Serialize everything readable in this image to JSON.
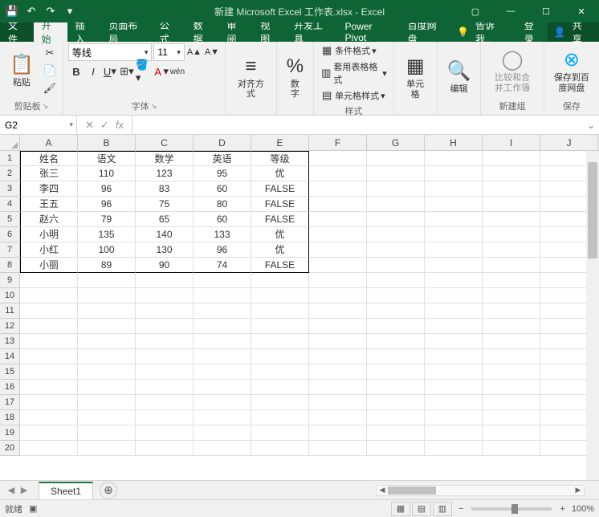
{
  "title": "新建 Microsoft Excel 工作表.xlsx - Excel",
  "tabs": {
    "file": "文件",
    "home": "开始",
    "insert": "插入",
    "layout": "页面布局",
    "formulas": "公式",
    "data": "数据",
    "review": "审阅",
    "view": "视图",
    "dev": "开发工具",
    "power": "Power Pivot",
    "baidu": "百度网盘",
    "tell_me": "告诉我...",
    "login": "登录",
    "share": "共享"
  },
  "ribbon": {
    "clipboard": {
      "paste": "粘贴",
      "label": "剪贴板"
    },
    "font": {
      "name": "等线",
      "size": "11",
      "label": "字体"
    },
    "align": {
      "label": "对齐方式"
    },
    "number": {
      "label": "数字"
    },
    "styles": {
      "cond": "条件格式",
      "tbl": "套用表格格式",
      "cell": "单元格样式",
      "label": "样式"
    },
    "cells": {
      "label": "单元格"
    },
    "editing": {
      "label": "编辑"
    },
    "newgroup": {
      "compare": "比较和合并工作簿",
      "label": "新建组"
    },
    "save": {
      "save_to": "保存到百度网盘",
      "label": "保存"
    }
  },
  "name_box": "G2",
  "formula": "",
  "columns": [
    "A",
    "B",
    "C",
    "D",
    "E",
    "F",
    "G",
    "H",
    "I",
    "J"
  ],
  "row_nums": [
    1,
    2,
    3,
    4,
    5,
    6,
    7,
    8,
    9,
    10,
    11,
    12,
    13,
    14,
    15,
    16,
    17,
    18,
    19,
    20
  ],
  "cells": {
    "A1": "姓名",
    "B1": "语文",
    "C1": "数学",
    "D1": "英语",
    "E1": "等级",
    "A2": "张三",
    "B2": "110",
    "C2": "123",
    "D2": "95",
    "E2": "优",
    "A3": "李四",
    "B3": "96",
    "C3": "83",
    "D3": "60",
    "E3": "FALSE",
    "A4": "王五",
    "B4": "96",
    "C4": "75",
    "D4": "80",
    "E4": "FALSE",
    "A5": "赵六",
    "B5": "79",
    "C5": "65",
    "D5": "60",
    "E5": "FALSE",
    "A6": "小明",
    "B6": "135",
    "C6": "140",
    "D6": "133",
    "E6": "优",
    "A7": "小红",
    "B7": "100",
    "C7": "130",
    "D7": "96",
    "E7": "优",
    "A8": "小丽",
    "B8": "89",
    "C8": "90",
    "D8": "74",
    "E8": "FALSE"
  },
  "sheet": "Sheet1",
  "status": {
    "ready": "就绪",
    "zoom": "100%"
  },
  "chart_data": {
    "type": "table",
    "columns": [
      "姓名",
      "语文",
      "数学",
      "英语",
      "等级"
    ],
    "rows": [
      [
        "张三",
        110,
        123,
        95,
        "优"
      ],
      [
        "李四",
        96,
        83,
        60,
        "FALSE"
      ],
      [
        "王五",
        96,
        75,
        80,
        "FALSE"
      ],
      [
        "赵六",
        79,
        65,
        60,
        "FALSE"
      ],
      [
        "小明",
        135,
        140,
        133,
        "优"
      ],
      [
        "小红",
        100,
        130,
        96,
        "优"
      ],
      [
        "小丽",
        89,
        90,
        74,
        "FALSE"
      ]
    ]
  }
}
